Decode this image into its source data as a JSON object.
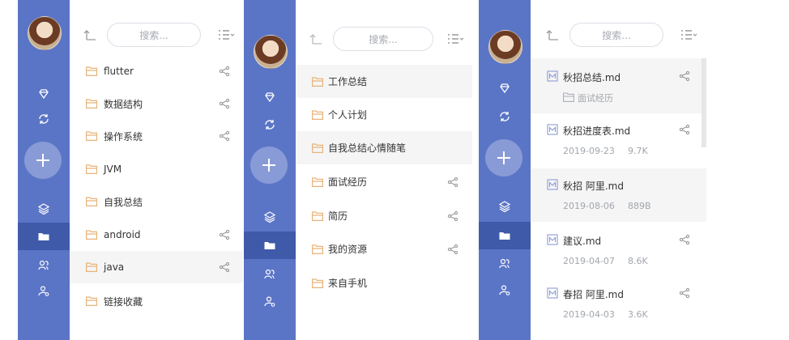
{
  "search_placeholder": "搜索...",
  "colors": {
    "sidebar": "#5b75c6",
    "sidebar_active": "#3f5aa8",
    "row_highlight": "#f5f5f5",
    "icon_gray": "#999999",
    "folder_orange": "#e8b37a",
    "md_blue": "#8d9ad6"
  },
  "sidebar_icons": [
    "gem-icon",
    "sync-icon",
    "add-icon",
    "layers-icon",
    "folder-icon",
    "user-group-icon",
    "user-settings-icon"
  ],
  "panel1": {
    "items": [
      {
        "label": "flutter",
        "share": true
      },
      {
        "label": "数据结构",
        "share": true
      },
      {
        "label": "操作系统",
        "share": true
      },
      {
        "label": "JVM",
        "share": false
      },
      {
        "label": "自我总结",
        "share": false
      },
      {
        "label": "android",
        "share": true
      },
      {
        "label": "java",
        "share": true,
        "highlight": true
      },
      {
        "label": "链接收藏",
        "share": false
      }
    ]
  },
  "panel2": {
    "items": [
      {
        "label": "工作总结",
        "share": false,
        "highlight": true
      },
      {
        "label": "个人计划",
        "share": false
      },
      {
        "label": "自我总结心情随笔",
        "share": false,
        "highlight": true
      },
      {
        "label": "面试经历",
        "share": true
      },
      {
        "label": "简历",
        "share": true
      },
      {
        "label": "我的资源",
        "share": true
      },
      {
        "label": "来自手机",
        "share": false
      }
    ]
  },
  "panel3": {
    "docs": [
      {
        "name": "秋招总结.md",
        "meta_folder": "面试经历",
        "highlight": true
      },
      {
        "name": "秋招进度表.md",
        "date": "2019-09-23",
        "size": "9.7K"
      },
      {
        "name": "秋招 阿里.md",
        "date": "2019-08-06",
        "size": "889B",
        "highlight": true
      },
      {
        "name": "建议.md",
        "date": "2019-04-07",
        "size": "8.6K"
      },
      {
        "name": "春招 阿里.md",
        "date": "2019-04-03",
        "size": "3.6K"
      }
    ]
  }
}
